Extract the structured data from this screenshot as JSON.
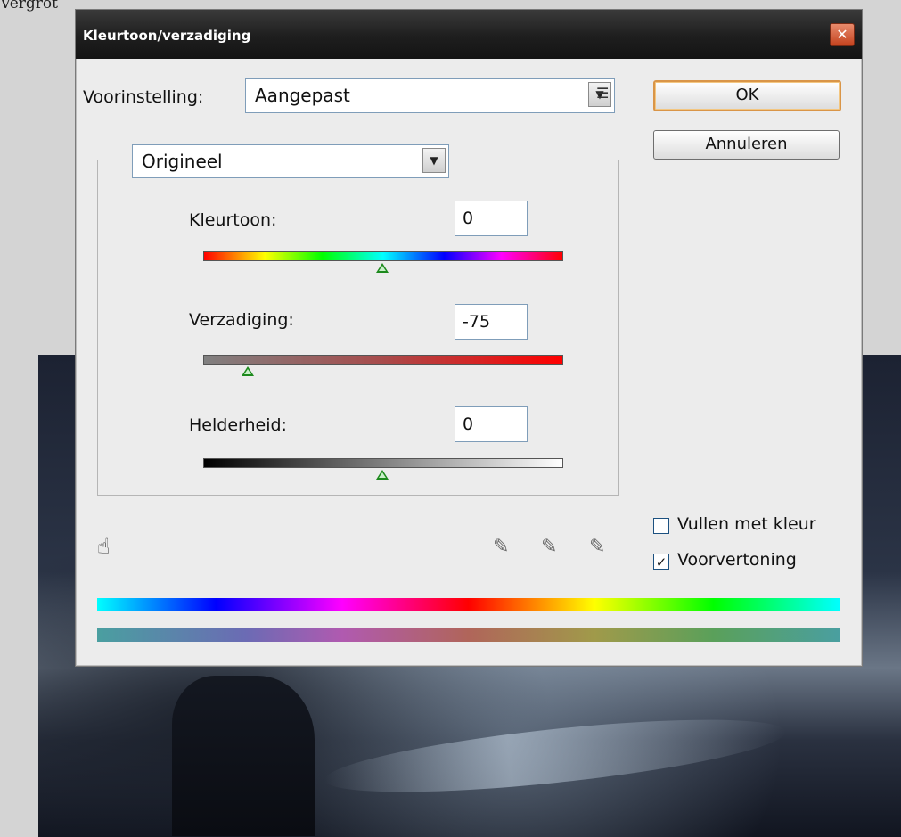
{
  "caption": "Vergrot",
  "dialog": {
    "title": "Kleurtoon/verzadiging",
    "close_label": "✕"
  },
  "preset": {
    "label": "Voorinstelling:",
    "value": "Aangepast"
  },
  "buttons": {
    "ok": "OK",
    "cancel": "Annuleren"
  },
  "channel": {
    "value": "Origineel"
  },
  "sliders": {
    "hue": {
      "label": "Kleurtoon:",
      "value": "0",
      "level": 0.5
    },
    "saturation": {
      "label": "Verzadiging:",
      "value": "-75",
      "level": 0.125
    },
    "lightness": {
      "label": "Helderheid:",
      "value": "0",
      "level": 0.5
    }
  },
  "options": {
    "colorize": {
      "label": "Vullen met kleur",
      "checked": false
    },
    "preview": {
      "label": "Voorvertoning",
      "checked": true
    }
  },
  "icons": {
    "preset_menu": "preset-menu-icon",
    "hand": "targeted-adjustment-hand-icon",
    "eyedropper": "eyedropper-icon",
    "eyedropper_add": "eyedropper-plus-icon",
    "eyedropper_subtract": "eyedropper-minus-icon"
  },
  "colors": {
    "default_button_border": "#d99548",
    "close_button": "#c4421e",
    "titlebar": "#1e1e1e"
  }
}
